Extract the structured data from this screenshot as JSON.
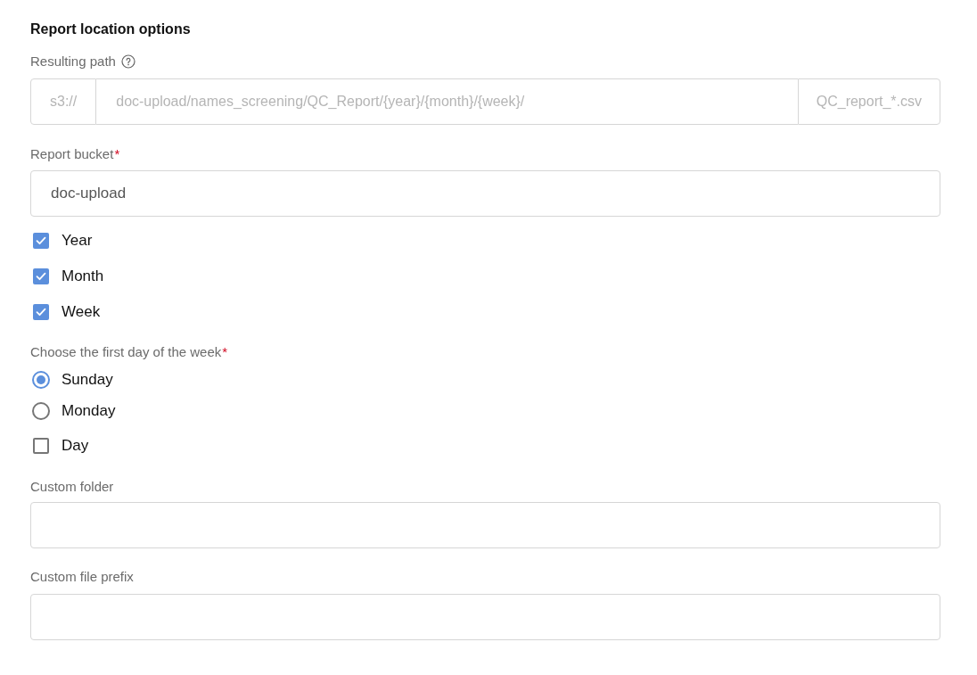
{
  "section": {
    "title": "Report location options"
  },
  "resulting_path": {
    "label": "Resulting path",
    "disabled": true,
    "prefix": "s3://",
    "path": "doc-upload/names_screening/QC_Report/{year}/{month}/{week}/",
    "suffix": "QC_report_*.csv"
  },
  "report_bucket": {
    "label": "Report bucket",
    "required_mark": "*",
    "value": "doc-upload"
  },
  "period_options": [
    {
      "label": "Year",
      "checked": true
    },
    {
      "label": "Month",
      "checked": true
    },
    {
      "label": "Week",
      "checked": true
    }
  ],
  "first_day_of_week": {
    "label": "Choose the first day of the week",
    "required_mark": "*",
    "options": [
      {
        "label": "Sunday",
        "selected": true
      },
      {
        "label": "Monday",
        "selected": false
      }
    ]
  },
  "day_option": {
    "label": "Day",
    "checked": false
  },
  "custom_folder": {
    "label": "Custom folder"
  },
  "custom_file_prefix": {
    "label": "Custom file prefix"
  }
}
